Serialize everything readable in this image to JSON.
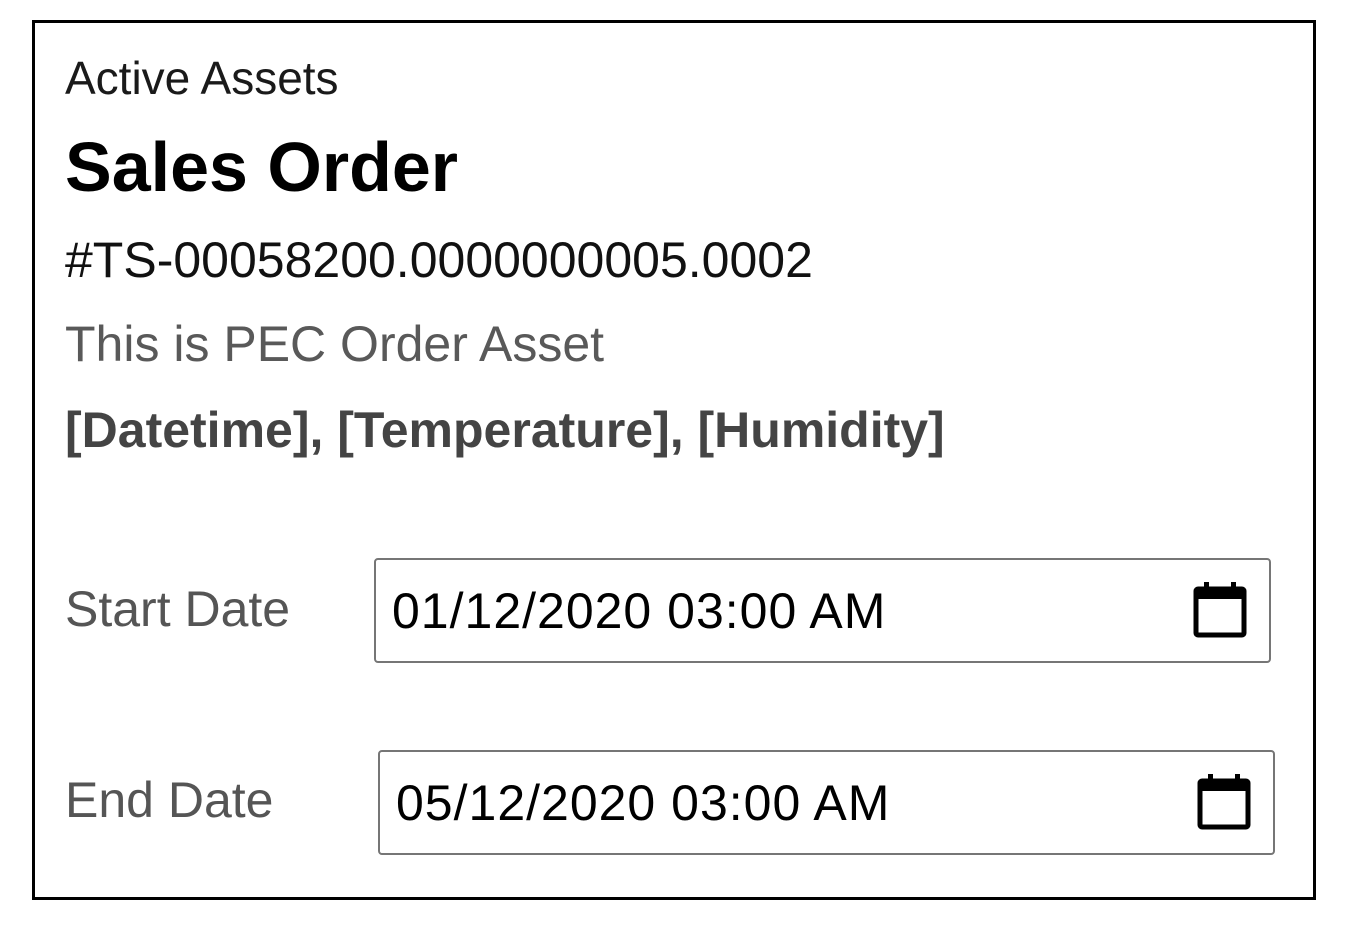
{
  "header": {
    "subtitle": "Active Assets",
    "title": "Sales Order",
    "order_id": "#TS-00058200.0000000005.0002",
    "description": "This is PEC Order Asset",
    "fields": "[Datetime], [Temperature], [Humidity]"
  },
  "start_date": {
    "label": "Start Date",
    "value": "01/12/2020 03:00 AM",
    "icon": "calendar-icon"
  },
  "end_date": {
    "label": "End Date",
    "value": "05/12/2020 03:00 AM",
    "icon": "calendar-icon"
  }
}
